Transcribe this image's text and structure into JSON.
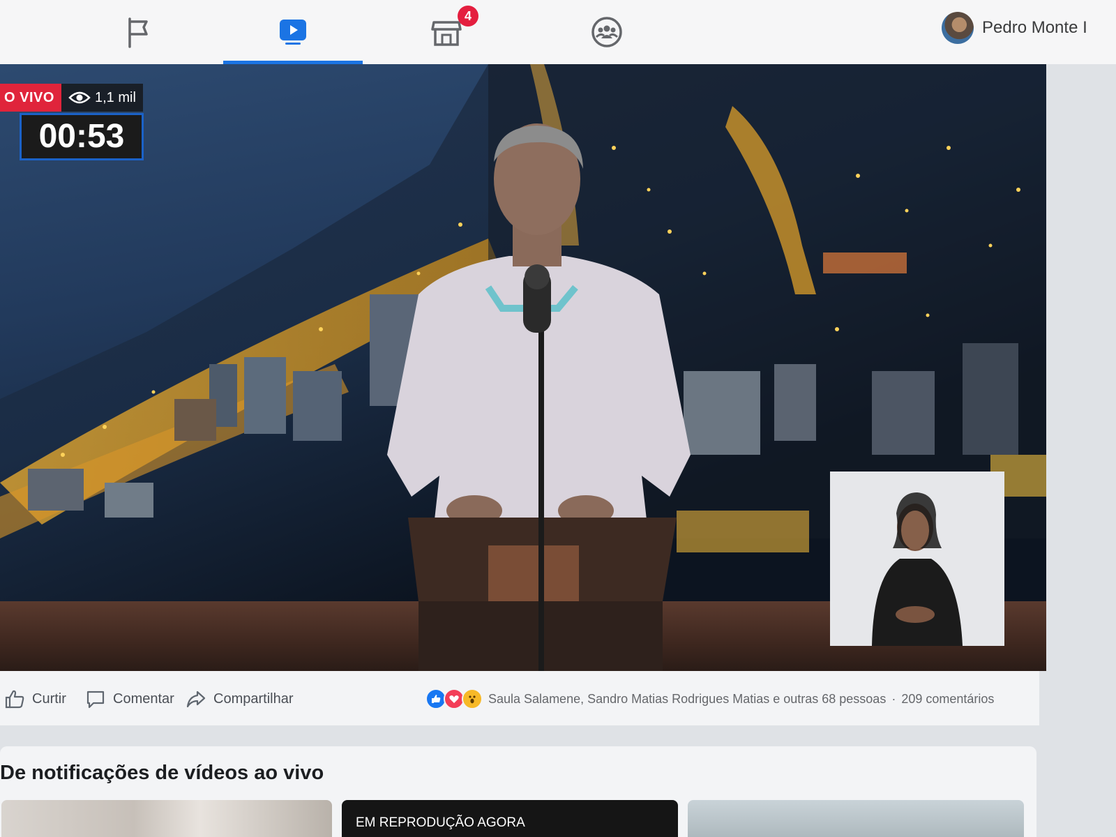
{
  "nav": {
    "tabs": [
      {
        "name": "pages",
        "icon": "flag-icon",
        "active": false
      },
      {
        "name": "watch",
        "icon": "play-icon",
        "active": true
      },
      {
        "name": "marketplace",
        "icon": "marketplace-icon",
        "active": false,
        "badge": "4"
      },
      {
        "name": "groups",
        "icon": "groups-icon",
        "active": false
      }
    ],
    "profile_name": "Pedro Monte I"
  },
  "video": {
    "live_label": "O VIVO",
    "viewers": "1,1 mil",
    "timer": "00:53"
  },
  "actions": {
    "like_label": "Curtir",
    "comment_label": "Comentar",
    "share_label": "Compartilhar",
    "reactions_text": "Saula Salamene, Sandro Matias Rodrigues Matias e outras 68 pessoas",
    "separator": "·",
    "comments_count": "209 comentários",
    "reaction_icons": [
      "like-icon",
      "love-icon",
      "wow-icon"
    ]
  },
  "live_section": {
    "title": "De notificações de vídeos ao vivo",
    "thumbnails": [
      {
        "label": ""
      },
      {
        "label": "EM REPRODUÇÃO AGORA"
      },
      {
        "label": ""
      }
    ]
  },
  "colors": {
    "accent": "#1b74e4",
    "badge": "#e41e3f",
    "live": "#e0243b"
  }
}
